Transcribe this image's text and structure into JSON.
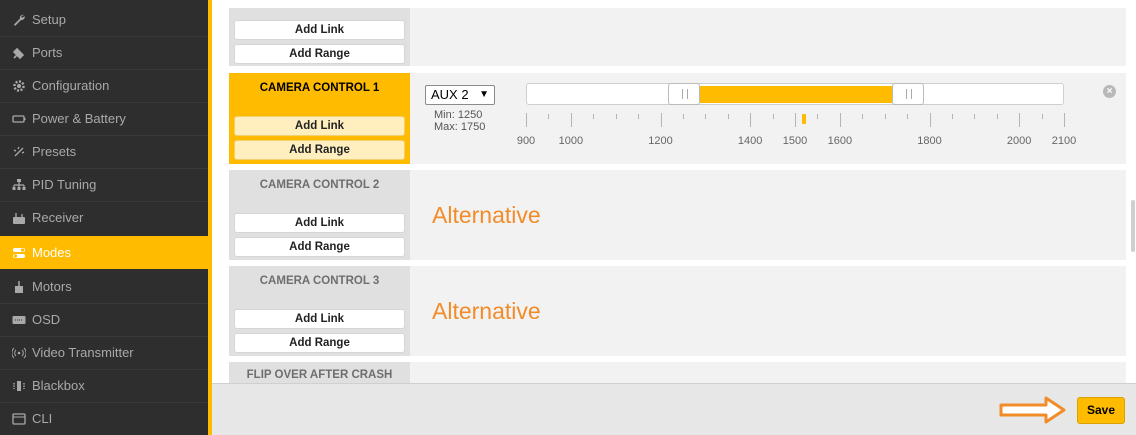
{
  "sidebar": {
    "items": [
      {
        "label": "Setup",
        "icon": "wrench-icon"
      },
      {
        "label": "Ports",
        "icon": "plug-icon"
      },
      {
        "label": "Configuration",
        "icon": "gear-icon"
      },
      {
        "label": "Power & Battery",
        "icon": "battery-icon"
      },
      {
        "label": "Presets",
        "icon": "presets-icon"
      },
      {
        "label": "PID Tuning",
        "icon": "pid-icon"
      },
      {
        "label": "Receiver",
        "icon": "receiver-icon"
      },
      {
        "label": "Modes",
        "icon": "modes-icon",
        "active": true
      },
      {
        "label": "Motors",
        "icon": "motor-icon"
      },
      {
        "label": "OSD",
        "icon": "osd-icon"
      },
      {
        "label": "Video Transmitter",
        "icon": "vtx-icon"
      },
      {
        "label": "Blackbox",
        "icon": "blackbox-icon"
      },
      {
        "label": "CLI",
        "icon": "cli-icon"
      }
    ]
  },
  "modes": {
    "top_partial": {
      "add_link": "Add Link",
      "add_range": "Add Range"
    },
    "camera1": {
      "name": "CAMERA CONTROL 1",
      "add_link": "Add Link",
      "add_range": "Add Range",
      "channel": "AUX 2",
      "min_label": "Min: 1250",
      "max_label": "Max: 1750",
      "range_min": 1250,
      "range_max": 1750,
      "current_value": 1520,
      "scale_min": 900,
      "scale_max": 2100,
      "ticks": [
        "900",
        "1000",
        "1200",
        "1400",
        "1500",
        "1600",
        "1800",
        "2000",
        "2100"
      ]
    },
    "camera2": {
      "name": "CAMERA CONTROL 2",
      "add_link": "Add Link",
      "add_range": "Add Range",
      "alt_text": "Alternative"
    },
    "camera3": {
      "name": "CAMERA CONTROL 3",
      "add_link": "Add Link",
      "add_range": "Add Range",
      "alt_text": "Alternative"
    },
    "flip": {
      "name": "FLIP OVER AFTER CRASH"
    }
  },
  "footer": {
    "save_label": "Save"
  },
  "colors": {
    "accent": "#ffbb00",
    "annotation": "#f28c28"
  }
}
